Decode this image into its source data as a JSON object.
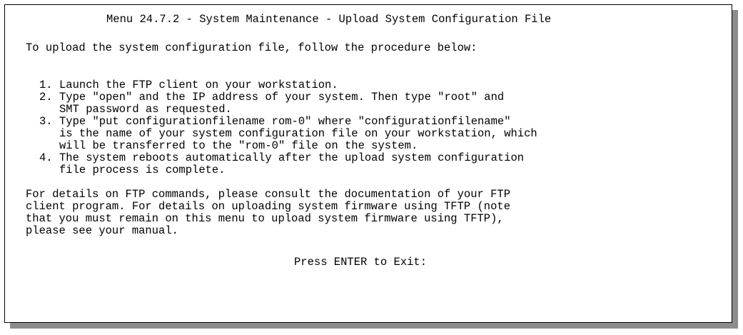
{
  "title": "Menu 24.7.2 - System Maintenance - Upload System Configuration File",
  "intro": "To upload the system configuration file, follow the procedure below:",
  "steps": [
    {
      "number": "1.",
      "lines": [
        "Launch the FTP client on your workstation."
      ]
    },
    {
      "number": "2.",
      "lines": [
        "Type \"open\" and the IP address of your system. Then type \"root\" and",
        "SMT password as requested."
      ]
    },
    {
      "number": "3.",
      "lines": [
        "Type \"put configurationfilename rom-0\" where \"configurationfilename\"",
        "is the name of your system configuration file on your workstation, which",
        "will be transferred to the \"rom-0\" file on the system."
      ]
    },
    {
      "number": "4.",
      "lines": [
        "The system reboots automatically after the upload system configuration",
        "file process is complete."
      ]
    }
  ],
  "details": [
    "For details on FTP commands, please consult the documentation of your FTP",
    "client program. For details on uploading system firmware using TFTP (note",
    "that you must remain on this menu to upload system firmware using TFTP),",
    "please see your manual."
  ],
  "prompt": "Press ENTER to Exit:"
}
